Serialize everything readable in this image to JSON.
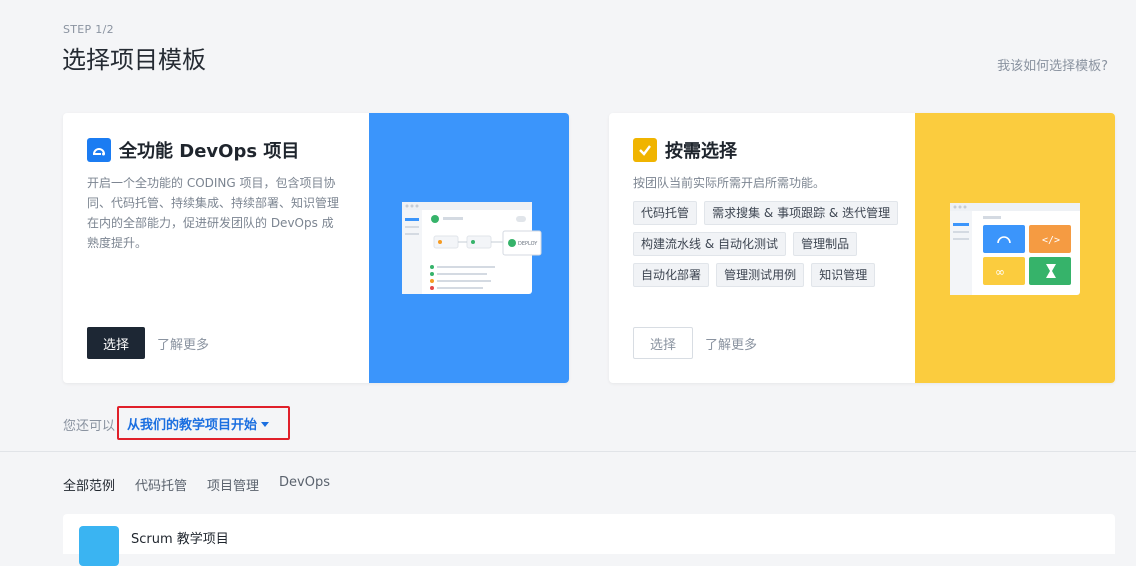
{
  "header": {
    "step": "STEP 1/2",
    "title": "选择项目模板",
    "help_link": "我该如何选择模板?"
  },
  "cards": [
    {
      "title": "全功能 DevOps 项目",
      "description": "开启一个全功能的 CODING 项目，包含项目协同、代码托管、持续集成、持续部署、知识管理在内的全部能力，促进研发团队的 DevOps 成熟度提升。",
      "select_label": "选择",
      "more_label": "了解更多",
      "illustration_label": "DEPLOY",
      "accent": "#3b95fb"
    },
    {
      "title": "按需选择",
      "description": "按团队当前实际所需开启所需功能。",
      "tags": [
        "代码托管",
        "需求搜集 & 事项跟踪 & 迭代管理",
        "构建流水线 & 自动化测试",
        "管理制品",
        "自动化部署",
        "管理测试用例",
        "知识管理"
      ],
      "select_label": "选择",
      "more_label": "了解更多",
      "accent": "#fbcc3e"
    }
  ],
  "alt": {
    "prefix": "您还可以",
    "link": "从我们的教学项目开始"
  },
  "filters": [
    "全部范例",
    "代码托管",
    "项目管理",
    "DevOps"
  ],
  "projects": [
    {
      "name": "Scrum 教学项目"
    }
  ]
}
